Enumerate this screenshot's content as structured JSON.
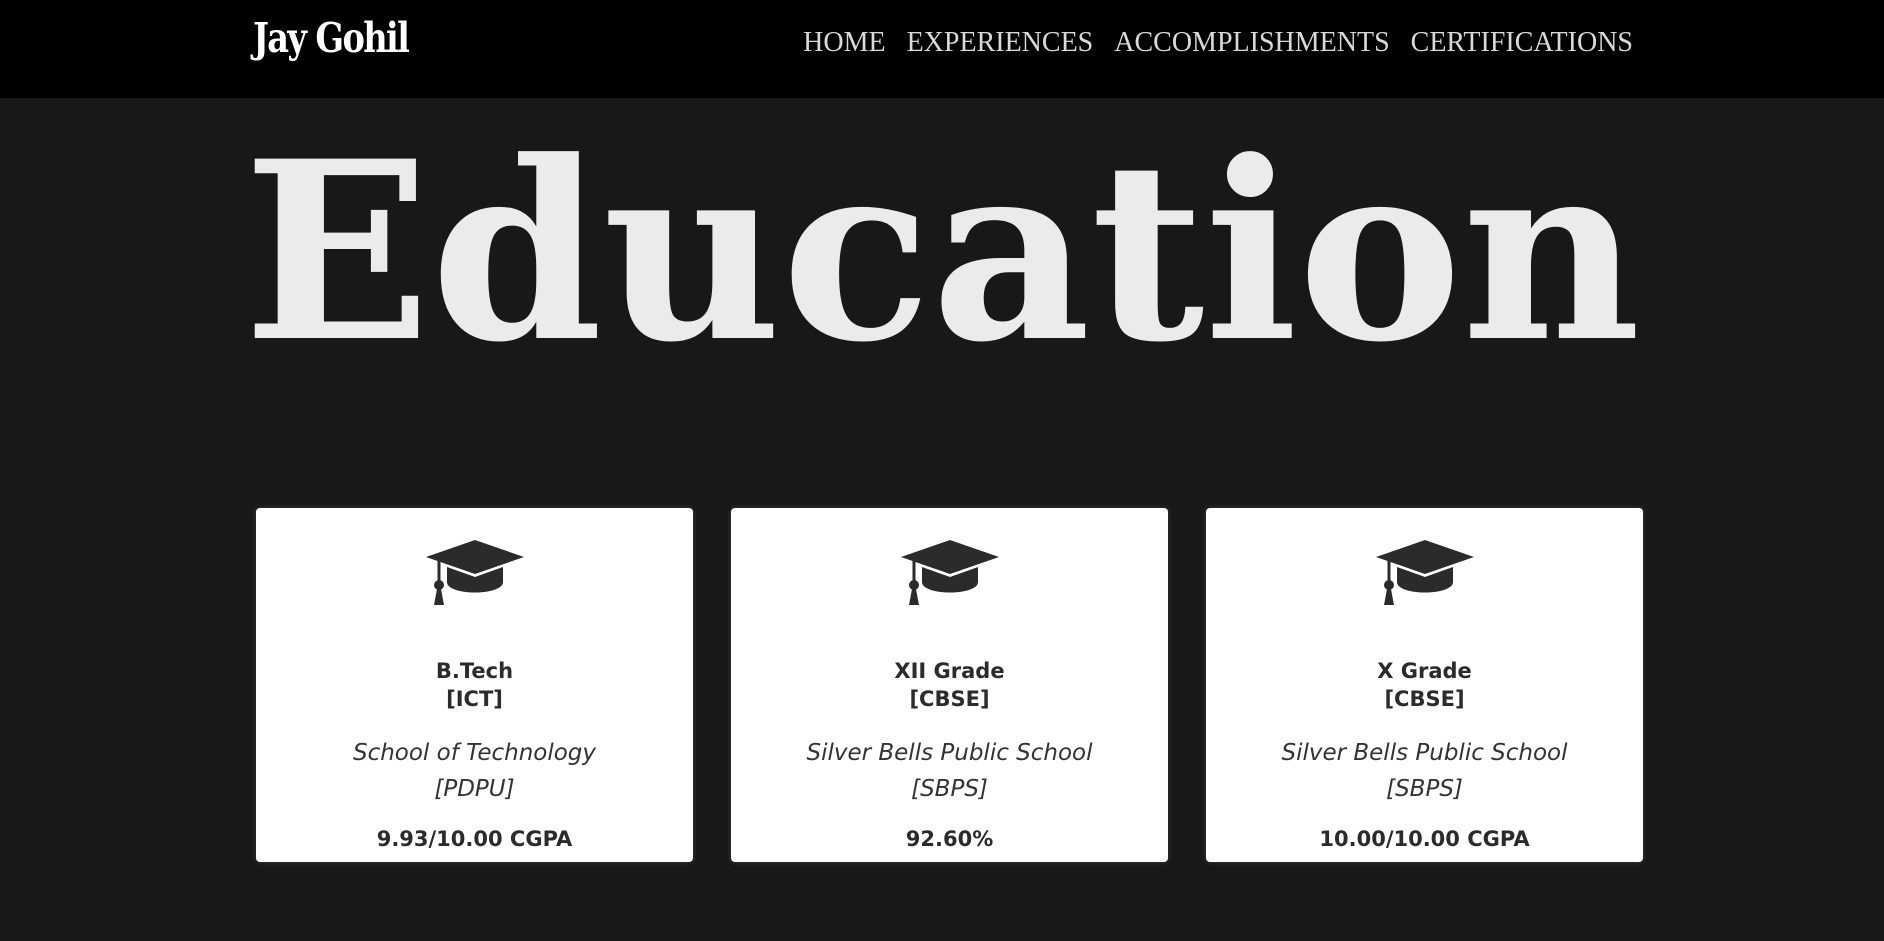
{
  "nav": {
    "brand": "Jay Gohil",
    "links": [
      "HOME",
      "EXPERIENCES",
      "ACCOMPLISHMENTS",
      "CERTIFICATIONS"
    ]
  },
  "main": {
    "title": "Education"
  },
  "education": [
    {
      "icon": "graduation-cap-icon",
      "degree_line1": "B.Tech",
      "degree_line2": "[ICT]",
      "school_line1": "School of Technology",
      "school_line2": "[PDPU]",
      "score": "9.93/10.00 CGPA"
    },
    {
      "icon": "graduation-cap-icon",
      "degree_line1": "XII Grade",
      "degree_line2": "[CBSE]",
      "school_line1": "Silver Bells Public School",
      "school_line2": "[SBPS]",
      "score": "92.60%"
    },
    {
      "icon": "graduation-cap-icon",
      "degree_line1": "X Grade",
      "degree_line2": "[CBSE]",
      "school_line1": "Silver Bells Public School",
      "school_line2": "[SBPS]",
      "score": "10.00/10.00 CGPA"
    }
  ],
  "colors": {
    "navbar_bg": "#000000",
    "page_bg": "#181818",
    "card_bg": "#ffffff",
    "title_text": "#ebebeb",
    "nav_text": "#d9d9d9",
    "card_text": "#2b2b2b"
  }
}
